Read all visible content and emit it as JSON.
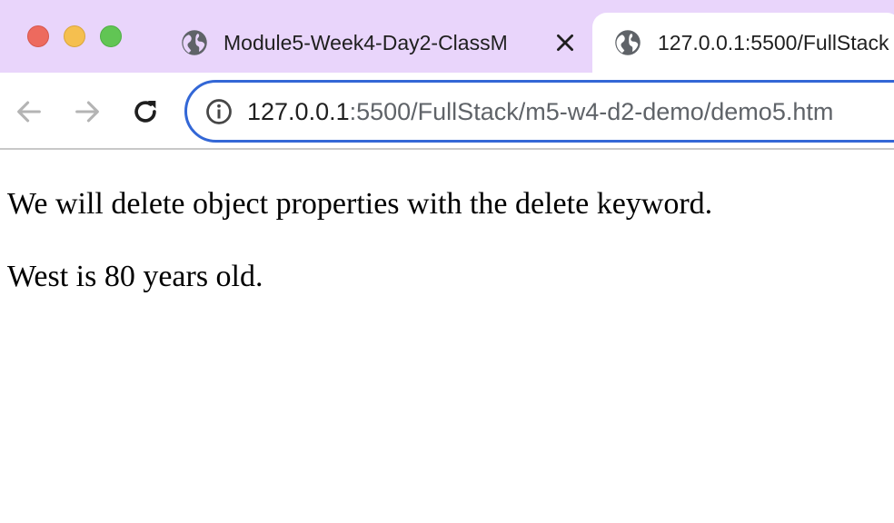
{
  "window": {
    "controls": [
      "close",
      "minimize",
      "zoom"
    ]
  },
  "tabs": [
    {
      "title": "Module5-Week4-Day2-ClassM",
      "favicon": "globe-icon",
      "active": false,
      "close_icon": "close-icon"
    },
    {
      "title": "127.0.0.1:5500/FullStack",
      "favicon": "globe-icon",
      "active": true
    }
  ],
  "toolbar": {
    "back_icon": "arrow-left-icon",
    "forward_icon": "arrow-right-icon",
    "reload_icon": "reload-icon",
    "address": {
      "info_icon": "info-icon",
      "host": "127.0.0.1",
      "rest": ":5500/FullStack/m5-w4-d2-demo/demo5.htm",
      "accent_color": "#3367d6"
    }
  },
  "page": {
    "paragraphs": [
      "We will delete object properties with the delete keyword.",
      "West is 80 years old."
    ]
  },
  "colors": {
    "tabstrip": "#e9d5fb",
    "traffic_red": "#ed6a5e",
    "traffic_yellow": "#f5bf4f",
    "traffic_green": "#61c554"
  }
}
